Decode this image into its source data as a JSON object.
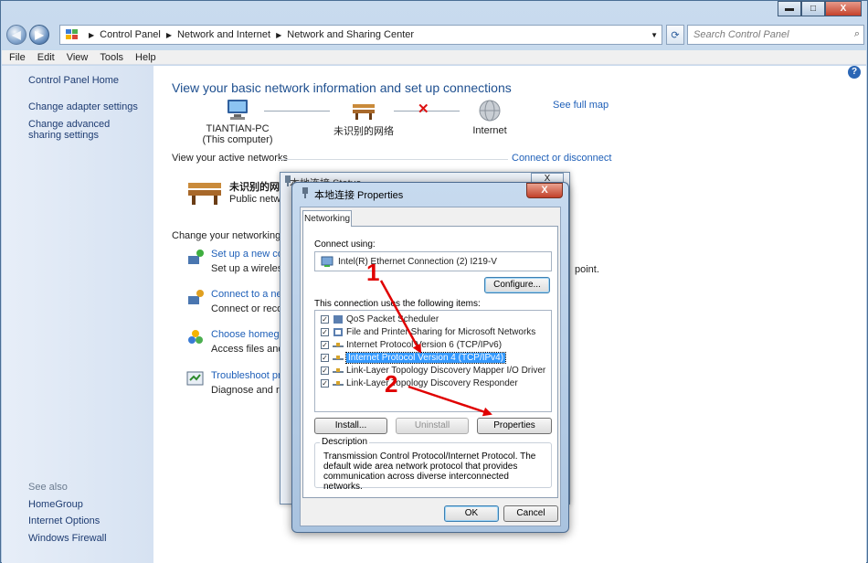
{
  "window": {
    "caption_buttons": {
      "minimize": "▬",
      "maximize": "□",
      "close": "X"
    }
  },
  "navbar": {
    "back": "◀",
    "forward": "▶",
    "address_parts": [
      "Control Panel",
      "Network and Internet",
      "Network and Sharing Center"
    ],
    "search_placeholder": "Search Control Panel",
    "refresh": "⟳",
    "search_icon": "⌕"
  },
  "menu": [
    "File",
    "Edit",
    "View",
    "Tools",
    "Help"
  ],
  "sidebar": {
    "home": "Control Panel Home",
    "links": [
      "Change adapter settings",
      "Change advanced sharing settings"
    ],
    "see_also_header": "See also",
    "see_also": [
      "HomeGroup",
      "Internet Options",
      "Windows Firewall"
    ]
  },
  "main": {
    "help": "?",
    "title": "View your basic network information and set up connections",
    "see_full_map": "See full map",
    "nodes": {
      "pc_name": "TIANTIAN-PC",
      "pc_sub": "(This computer)",
      "network": "未识别的网络",
      "internet": "Internet"
    },
    "active_label": "View your active networks",
    "connect_disconnect": "Connect or disconnect",
    "active_net_name": "未识别的网",
    "active_net_type": "Public netwo",
    "right_fragment": "point.",
    "settings_label": "Change your networking se",
    "tasks": [
      {
        "title": "Set up a new conn",
        "desc": "Set up a wireless,"
      },
      {
        "title": "Connect to a netw",
        "desc": "Connect or recon"
      },
      {
        "title": "Choose homegrou",
        "desc": "Access files and p"
      },
      {
        "title": "Troubleshoot pro",
        "desc": "Diagnose and rep"
      }
    ]
  },
  "status_window": {
    "title": "本地连接 Status",
    "close": "X"
  },
  "dialog": {
    "title": "本地连接 Properties",
    "close": "X",
    "tab": "Networking",
    "connect_using_label": "Connect using:",
    "adapter": "Intel(R) Ethernet Connection (2) I219-V",
    "configure": "Configure...",
    "items_label": "This connection uses the following items:",
    "items": [
      {
        "label": "QoS Packet Scheduler",
        "checked": true,
        "selected": false
      },
      {
        "label": "File and Printer Sharing for Microsoft Networks",
        "checked": true,
        "selected": false
      },
      {
        "label": "Internet Protocol Version 6 (TCP/IPv6)",
        "checked": true,
        "selected": false
      },
      {
        "label": "Internet Protocol Version 4 (TCP/IPv4)",
        "checked": true,
        "selected": true
      },
      {
        "label": "Link-Layer Topology Discovery Mapper I/O Driver",
        "checked": true,
        "selected": false
      },
      {
        "label": "Link-Layer Topology Discovery Responder",
        "checked": true,
        "selected": false
      }
    ],
    "check_mark": "✓",
    "install": "Install...",
    "uninstall": "Uninstall",
    "properties": "Properties",
    "description_label": "Description",
    "description": "Transmission Control Protocol/Internet Protocol. The default wide area network protocol that provides communication across diverse interconnected networks.",
    "ok": "OK",
    "cancel": "Cancel"
  },
  "annotations": {
    "one": "1",
    "two": "2",
    "color": "#e00000"
  }
}
